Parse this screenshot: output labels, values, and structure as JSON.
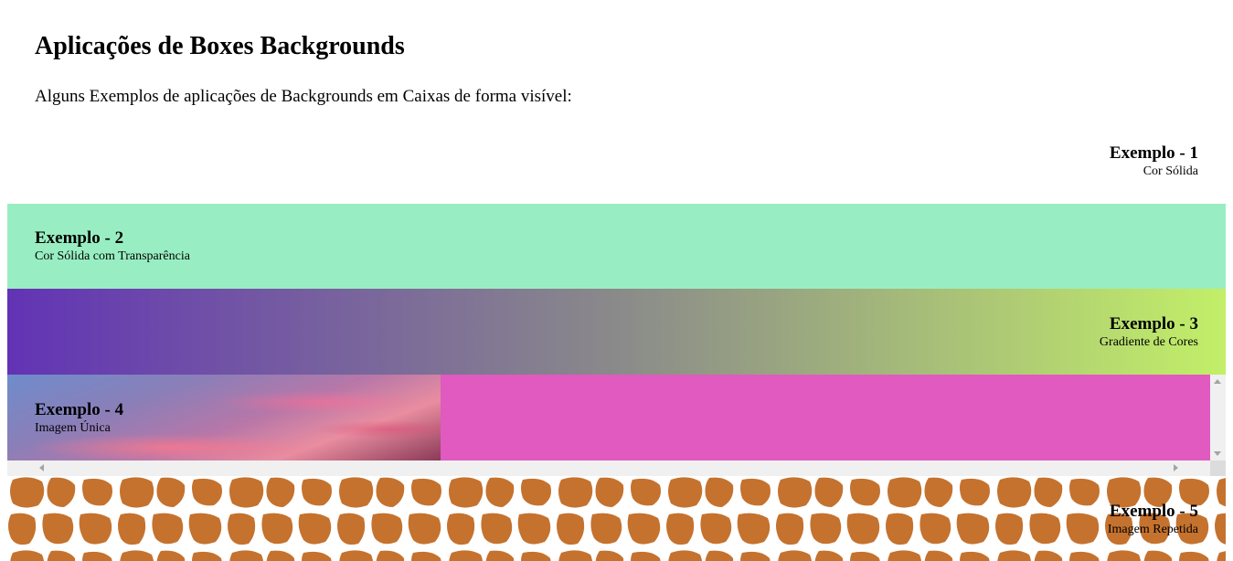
{
  "page": {
    "title": "Aplicações de Boxes Backgrounds",
    "intro": "Alguns Exemplos de aplicações de Backgrounds em Caixas de forma visível:"
  },
  "boxes": [
    {
      "title": "Exemplo - 1",
      "subtitle": "Cor Sólida",
      "align": "right",
      "background": "#ffffff"
    },
    {
      "title": "Exemplo - 2",
      "subtitle": "Cor Sólida com Transparência",
      "align": "left",
      "background": "#98efbd"
    },
    {
      "title": "Exemplo - 3",
      "subtitle": "Gradiente de Cores",
      "align": "right",
      "gradient": [
        "#6233b5",
        "#8a8a8a",
        "#c2ef68"
      ]
    },
    {
      "title": "Exemplo - 4",
      "subtitle": "Imagem Única",
      "align": "left",
      "background": "#e05ac0",
      "image": "sunset-sky-image"
    },
    {
      "title": "Exemplo - 5",
      "subtitle": "Imagem Repetida",
      "align": "right",
      "pattern": "giraffe-pattern",
      "pattern_color": "#c5722e"
    }
  ]
}
